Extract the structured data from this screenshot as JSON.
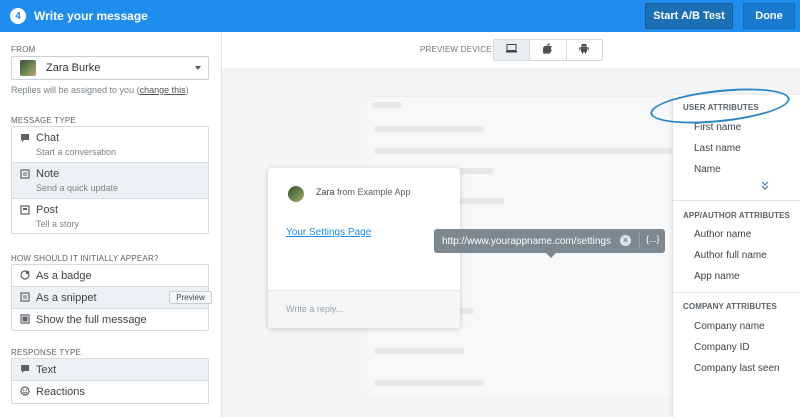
{
  "header": {
    "step": "4",
    "title": "Write your message",
    "ab_test_label": "Start A/B Test",
    "done_label": "Done"
  },
  "sidebar": {
    "from_label": "FROM",
    "from_name": "Zara Burke",
    "replies_text": "Replies will be assigned to you (",
    "replies_link": "change this",
    "replies_close": ")",
    "message_type_label": "MESSAGE TYPE",
    "message_types": [
      {
        "title": "Chat",
        "subtitle": "Start a conversation",
        "icon": "chat-bubble-icon",
        "selected": false
      },
      {
        "title": "Note",
        "subtitle": "Send a quick update",
        "icon": "note-icon",
        "selected": true
      },
      {
        "title": "Post",
        "subtitle": "Tell a story",
        "icon": "post-icon",
        "selected": false
      }
    ],
    "appear_label": "HOW SHOULD IT INITIALLY APPEAR?",
    "appear_options": [
      {
        "title": "As a badge",
        "icon": "badge-icon",
        "selected": false
      },
      {
        "title": "As a snippet",
        "icon": "snippet-icon",
        "selected": true,
        "chip": "Preview"
      },
      {
        "title": "Show the full message",
        "icon": "full-message-icon",
        "selected": false
      }
    ],
    "response_label": "RESPONSE TYPE",
    "response_options": [
      {
        "title": "Text",
        "icon": "text-bubble-icon",
        "selected": true
      },
      {
        "title": "Reactions",
        "icon": "smiley-icon",
        "selected": false
      }
    ]
  },
  "preview": {
    "device_label": "PREVIEW DEVICE",
    "devices": [
      "desktop-icon",
      "apple-icon",
      "android-icon"
    ],
    "selected_device": "desktop-icon",
    "card": {
      "author": "Zara",
      "from_text": "from Example App",
      "link_text": "Your Settings Page",
      "reply_placeholder": "Write a reply..."
    },
    "tooltip": {
      "url": "http://www.yourappname.com/settings",
      "var_button": "{...}"
    }
  },
  "attributes": {
    "user_header": "USER ATTRIBUTES",
    "user_items": [
      "First name",
      "Last name",
      "Name"
    ],
    "more_icon": "chevron-double-down-icon",
    "app_header": "APP/AUTHOR ATTRIBUTES",
    "app_items": [
      "Author name",
      "Author full name",
      "App name"
    ],
    "company_header": "COMPANY ATTRIBUTES",
    "company_items": [
      "Company name",
      "Company ID",
      "Company last seen"
    ]
  },
  "colors": {
    "brand_blue": "#1f8ded",
    "annotation_blue": "#2a87c4"
  }
}
